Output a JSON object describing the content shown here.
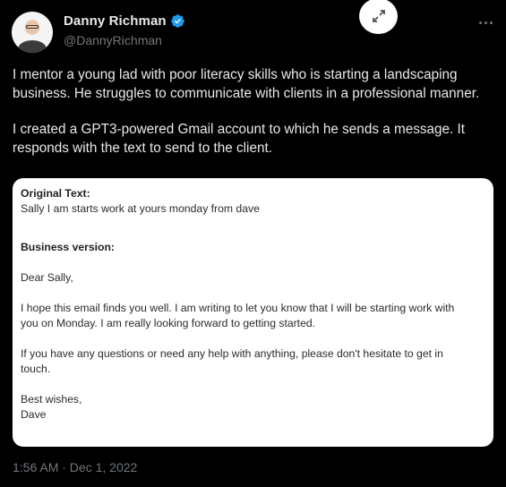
{
  "author": {
    "name": "Danny Richman",
    "handle": "@DannyRichman"
  },
  "tweet": {
    "paragraph1": "I mentor a young lad with poor literacy skills who is starting a landscaping business. He struggles to communicate with clients in a professional manner.",
    "paragraph2": "I created a GPT3-powered Gmail account to which he sends a message. It responds with the text to send to the client."
  },
  "image_card": {
    "original_label": "Original Text:",
    "original_text": "Sally I am starts work at yours monday from dave",
    "business_label": "Business version:",
    "greeting": "Dear Sally,",
    "body_line1": "I hope this email finds you well. I am writing to let you know that I will be starting work with",
    "body_line2": "you on Monday. I am really looking forward to getting started.",
    "body_line3": "If you have any questions or need any help with anything, please don't hesitate to get in",
    "body_line4": "touch.",
    "signoff": "Best wishes,",
    "signature": "Dave"
  },
  "timestamp": "1:56 AM · Dec 1, 2022",
  "icons": {
    "verified": "verified-badge-icon",
    "expand": "expand-icon",
    "more": "more-options-icon"
  },
  "colors": {
    "background": "#000000",
    "text_primary": "#e7e9ea",
    "text_secondary": "#71767b",
    "verified_blue": "#1d9bf0",
    "card_background": "#ffffff"
  }
}
